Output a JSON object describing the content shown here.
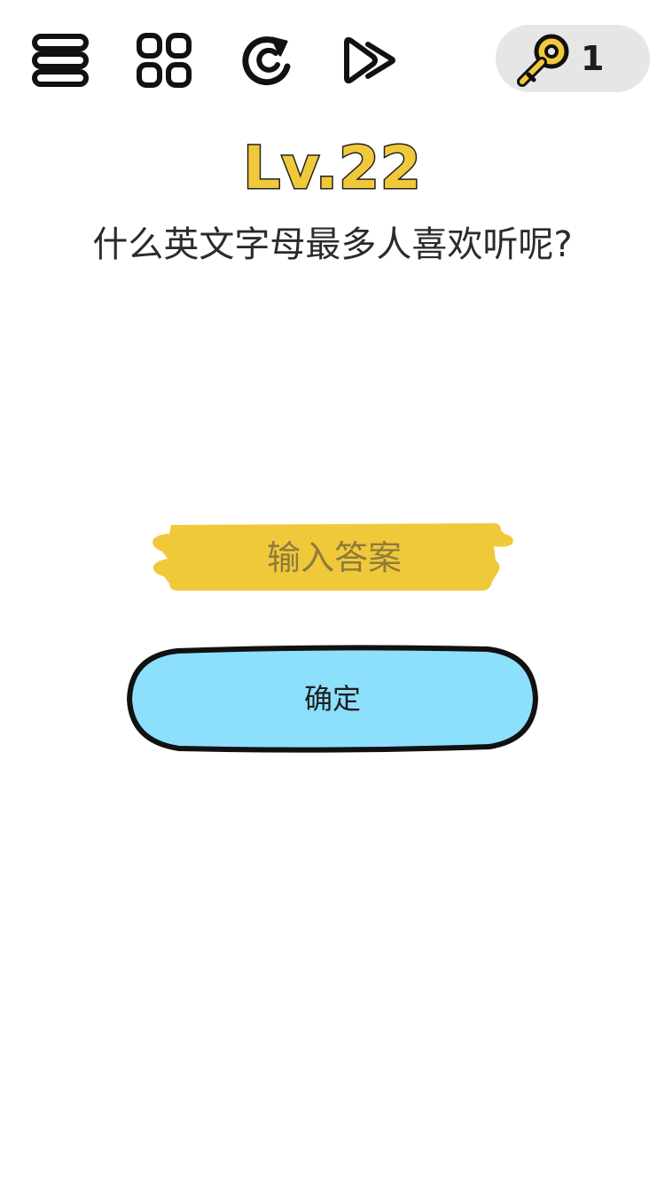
{
  "toolbar": {
    "menu_icon": "menu-icon",
    "levels_icon": "grid-icon",
    "restart_icon": "restart-icon",
    "skip_icon": "skip-icon",
    "key_icon": "key-icon",
    "key_count": "1"
  },
  "level": {
    "title": "Lv.22",
    "question": "什么英文字母最多人喜欢听呢?"
  },
  "answer": {
    "placeholder": "输入答案",
    "value": ""
  },
  "confirm": {
    "label": "确定"
  },
  "colors": {
    "title_fill": "#f0c93a",
    "brush_yellow": "#f0c93a",
    "button_blue": "#8de0fc",
    "key_gold": "#f2c93c",
    "pill_gray": "#e6e6e6"
  }
}
